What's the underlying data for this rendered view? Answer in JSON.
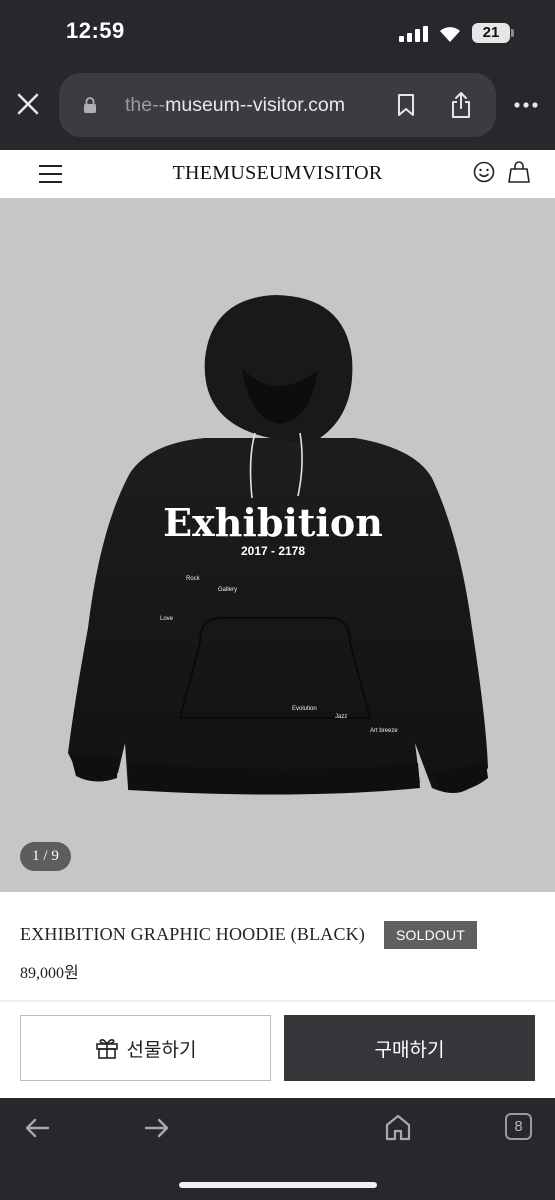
{
  "status_bar": {
    "time": "12:59",
    "battery": "21"
  },
  "browser": {
    "url_dim": "the--",
    "url_main": "museum--visitor.com",
    "tab_count": "8"
  },
  "site": {
    "brand": "THEMUSEUMVISITOR"
  },
  "product": {
    "image_pager": "1 / 9",
    "graphic_title": "Exhibition",
    "graphic_years": "2017 - 2178",
    "graphic_words": [
      "Rock",
      "Gallery",
      "Love",
      "Evolution",
      "Jazz",
      "Art breeze"
    ],
    "name": "EXHIBITION GRAPHIC HOODIE (BLACK)",
    "badge": "SOLDOUT",
    "price": "89,000원"
  },
  "actions": {
    "gift_label": "선물하기",
    "buy_label": "구매하기"
  },
  "colors": {
    "chrome_bg": "#26282c",
    "image_bg": "#c6c6c7",
    "hoodie": "#161616",
    "buy_button": "#36373a",
    "badge_bg": "#5f5f61"
  }
}
